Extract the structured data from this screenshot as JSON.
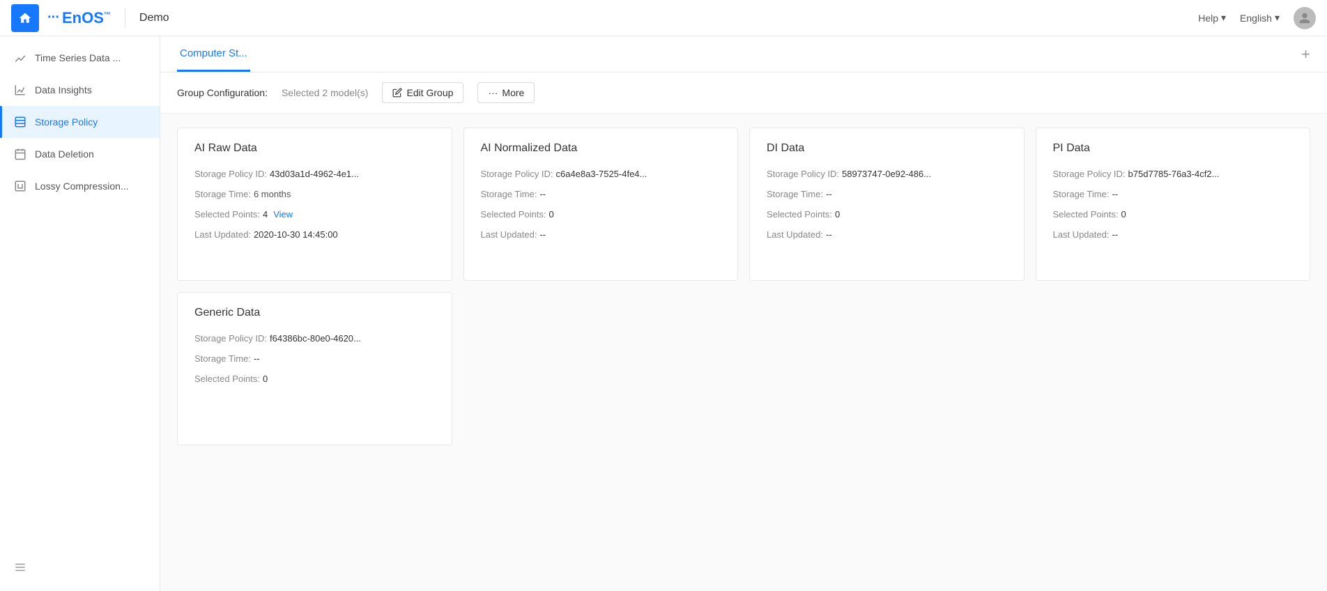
{
  "topNav": {
    "demo": "Demo",
    "help": "Help",
    "language": "English",
    "logoText": "EnOS"
  },
  "sidebar": {
    "items": [
      {
        "id": "time-series",
        "label": "Time Series Data ...",
        "icon": "chart-icon"
      },
      {
        "id": "data-insights",
        "label": "Data Insights",
        "icon": "insights-icon"
      },
      {
        "id": "storage-policy",
        "label": "Storage Policy",
        "icon": "storage-icon",
        "active": true
      },
      {
        "id": "data-deletion",
        "label": "Data Deletion",
        "icon": "deletion-icon"
      },
      {
        "id": "lossy-compression",
        "label": "Lossy Compression...",
        "icon": "compress-icon"
      }
    ]
  },
  "header": {
    "tab": "Computer St...",
    "addBtn": "+"
  },
  "toolbar": {
    "groupConfigLabel": "Group Configuration:",
    "selectedModels": "Selected 2 model(s)",
    "editGroupLabel": "Edit Group",
    "moreLabel": "More"
  },
  "cards": [
    {
      "id": "ai-raw-data",
      "title": "AI Raw Data",
      "storagePolicyId": "43d03a1d-4962-4e1...",
      "storageTime": "6 months",
      "selectedPoints": "4",
      "hasViewLink": true,
      "viewLabel": "View",
      "lastUpdated": "2020-10-30 14:45:00"
    },
    {
      "id": "ai-normalized-data",
      "title": "AI Normalized Data",
      "storagePolicyId": "c6a4e8a3-7525-4fe4...",
      "storageTime": "--",
      "selectedPoints": "0",
      "hasViewLink": false,
      "lastUpdated": "--"
    },
    {
      "id": "di-data",
      "title": "DI Data",
      "storagePolicyId": "58973747-0e92-486...",
      "storageTime": "--",
      "selectedPoints": "0",
      "hasViewLink": false,
      "lastUpdated": "--"
    },
    {
      "id": "pi-data",
      "title": "PI Data",
      "storagePolicyId": "b75d7785-76a3-4cf2...",
      "storageTime": "--",
      "selectedPoints": "0",
      "hasViewLink": false,
      "lastUpdated": "--"
    }
  ],
  "cards2": [
    {
      "id": "generic-data",
      "title": "Generic Data",
      "storagePolicyId": "f64386bc-80e0-4620...",
      "storageTime": "--",
      "selectedPoints": "0",
      "hasViewLink": false,
      "lastUpdated": "--"
    }
  ],
  "labels": {
    "storagePolicyId": "Storage Policy ID:",
    "storageTime": "Storage Time:",
    "selectedPoints": "Selected Points:",
    "lastUpdated": "Last Updated:"
  }
}
